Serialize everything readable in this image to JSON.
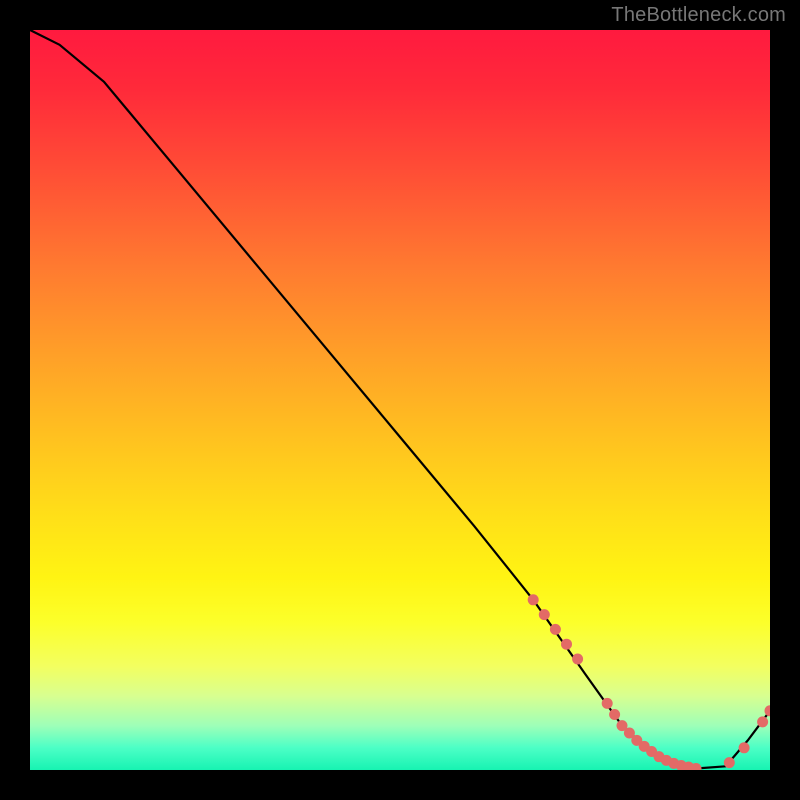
{
  "watermark": "TheBottleneck.com",
  "chart_data": {
    "type": "line",
    "title": "",
    "xlabel": "",
    "ylabel": "",
    "xlim": [
      0,
      100
    ],
    "ylim": [
      0,
      100
    ],
    "series": [
      {
        "name": "bottleneck-curve",
        "x": [
          0,
          4,
          10,
          20,
          30,
          40,
          50,
          60,
          68,
          75,
          80,
          85,
          90,
          94,
          97,
          100
        ],
        "y": [
          100,
          98,
          93,
          81,
          69,
          57,
          45,
          33,
          23,
          13,
          6,
          1.5,
          0.2,
          0.5,
          4,
          8
        ]
      }
    ],
    "highlight_points": {
      "name": "highlighted-models",
      "x": [
        68.0,
        69.5,
        71.0,
        72.5,
        74.0,
        78.0,
        79.0,
        80.0,
        81.0,
        82.0,
        83.0,
        84.0,
        85.0,
        86.0,
        87.0,
        88.0,
        89.0,
        90.0,
        94.5,
        96.5,
        99.0,
        100.0
      ],
      "y": [
        23.0,
        21.0,
        19.0,
        17.0,
        15.0,
        9.0,
        7.5,
        6.0,
        5.0,
        4.0,
        3.2,
        2.5,
        1.8,
        1.3,
        0.9,
        0.6,
        0.4,
        0.2,
        1.0,
        3.0,
        6.5,
        8.0
      ]
    },
    "gradient_stops": [
      {
        "pct": 0,
        "color": "#ff1a3f"
      },
      {
        "pct": 8,
        "color": "#ff2a3a"
      },
      {
        "pct": 18,
        "color": "#ff4a36"
      },
      {
        "pct": 32,
        "color": "#ff7a30"
      },
      {
        "pct": 44,
        "color": "#ffa028"
      },
      {
        "pct": 56,
        "color": "#ffc41f"
      },
      {
        "pct": 66,
        "color": "#ffe018"
      },
      {
        "pct": 74,
        "color": "#fff413"
      },
      {
        "pct": 80,
        "color": "#fcff2a"
      },
      {
        "pct": 86,
        "color": "#f3ff60"
      },
      {
        "pct": 90,
        "color": "#d8ff90"
      },
      {
        "pct": 94,
        "color": "#9effb8"
      },
      {
        "pct": 97,
        "color": "#4cffc6"
      },
      {
        "pct": 100,
        "color": "#17f3b2"
      }
    ],
    "colors": {
      "curve": "#000000",
      "points": "#e36a66",
      "background_frame": "#000000"
    }
  }
}
